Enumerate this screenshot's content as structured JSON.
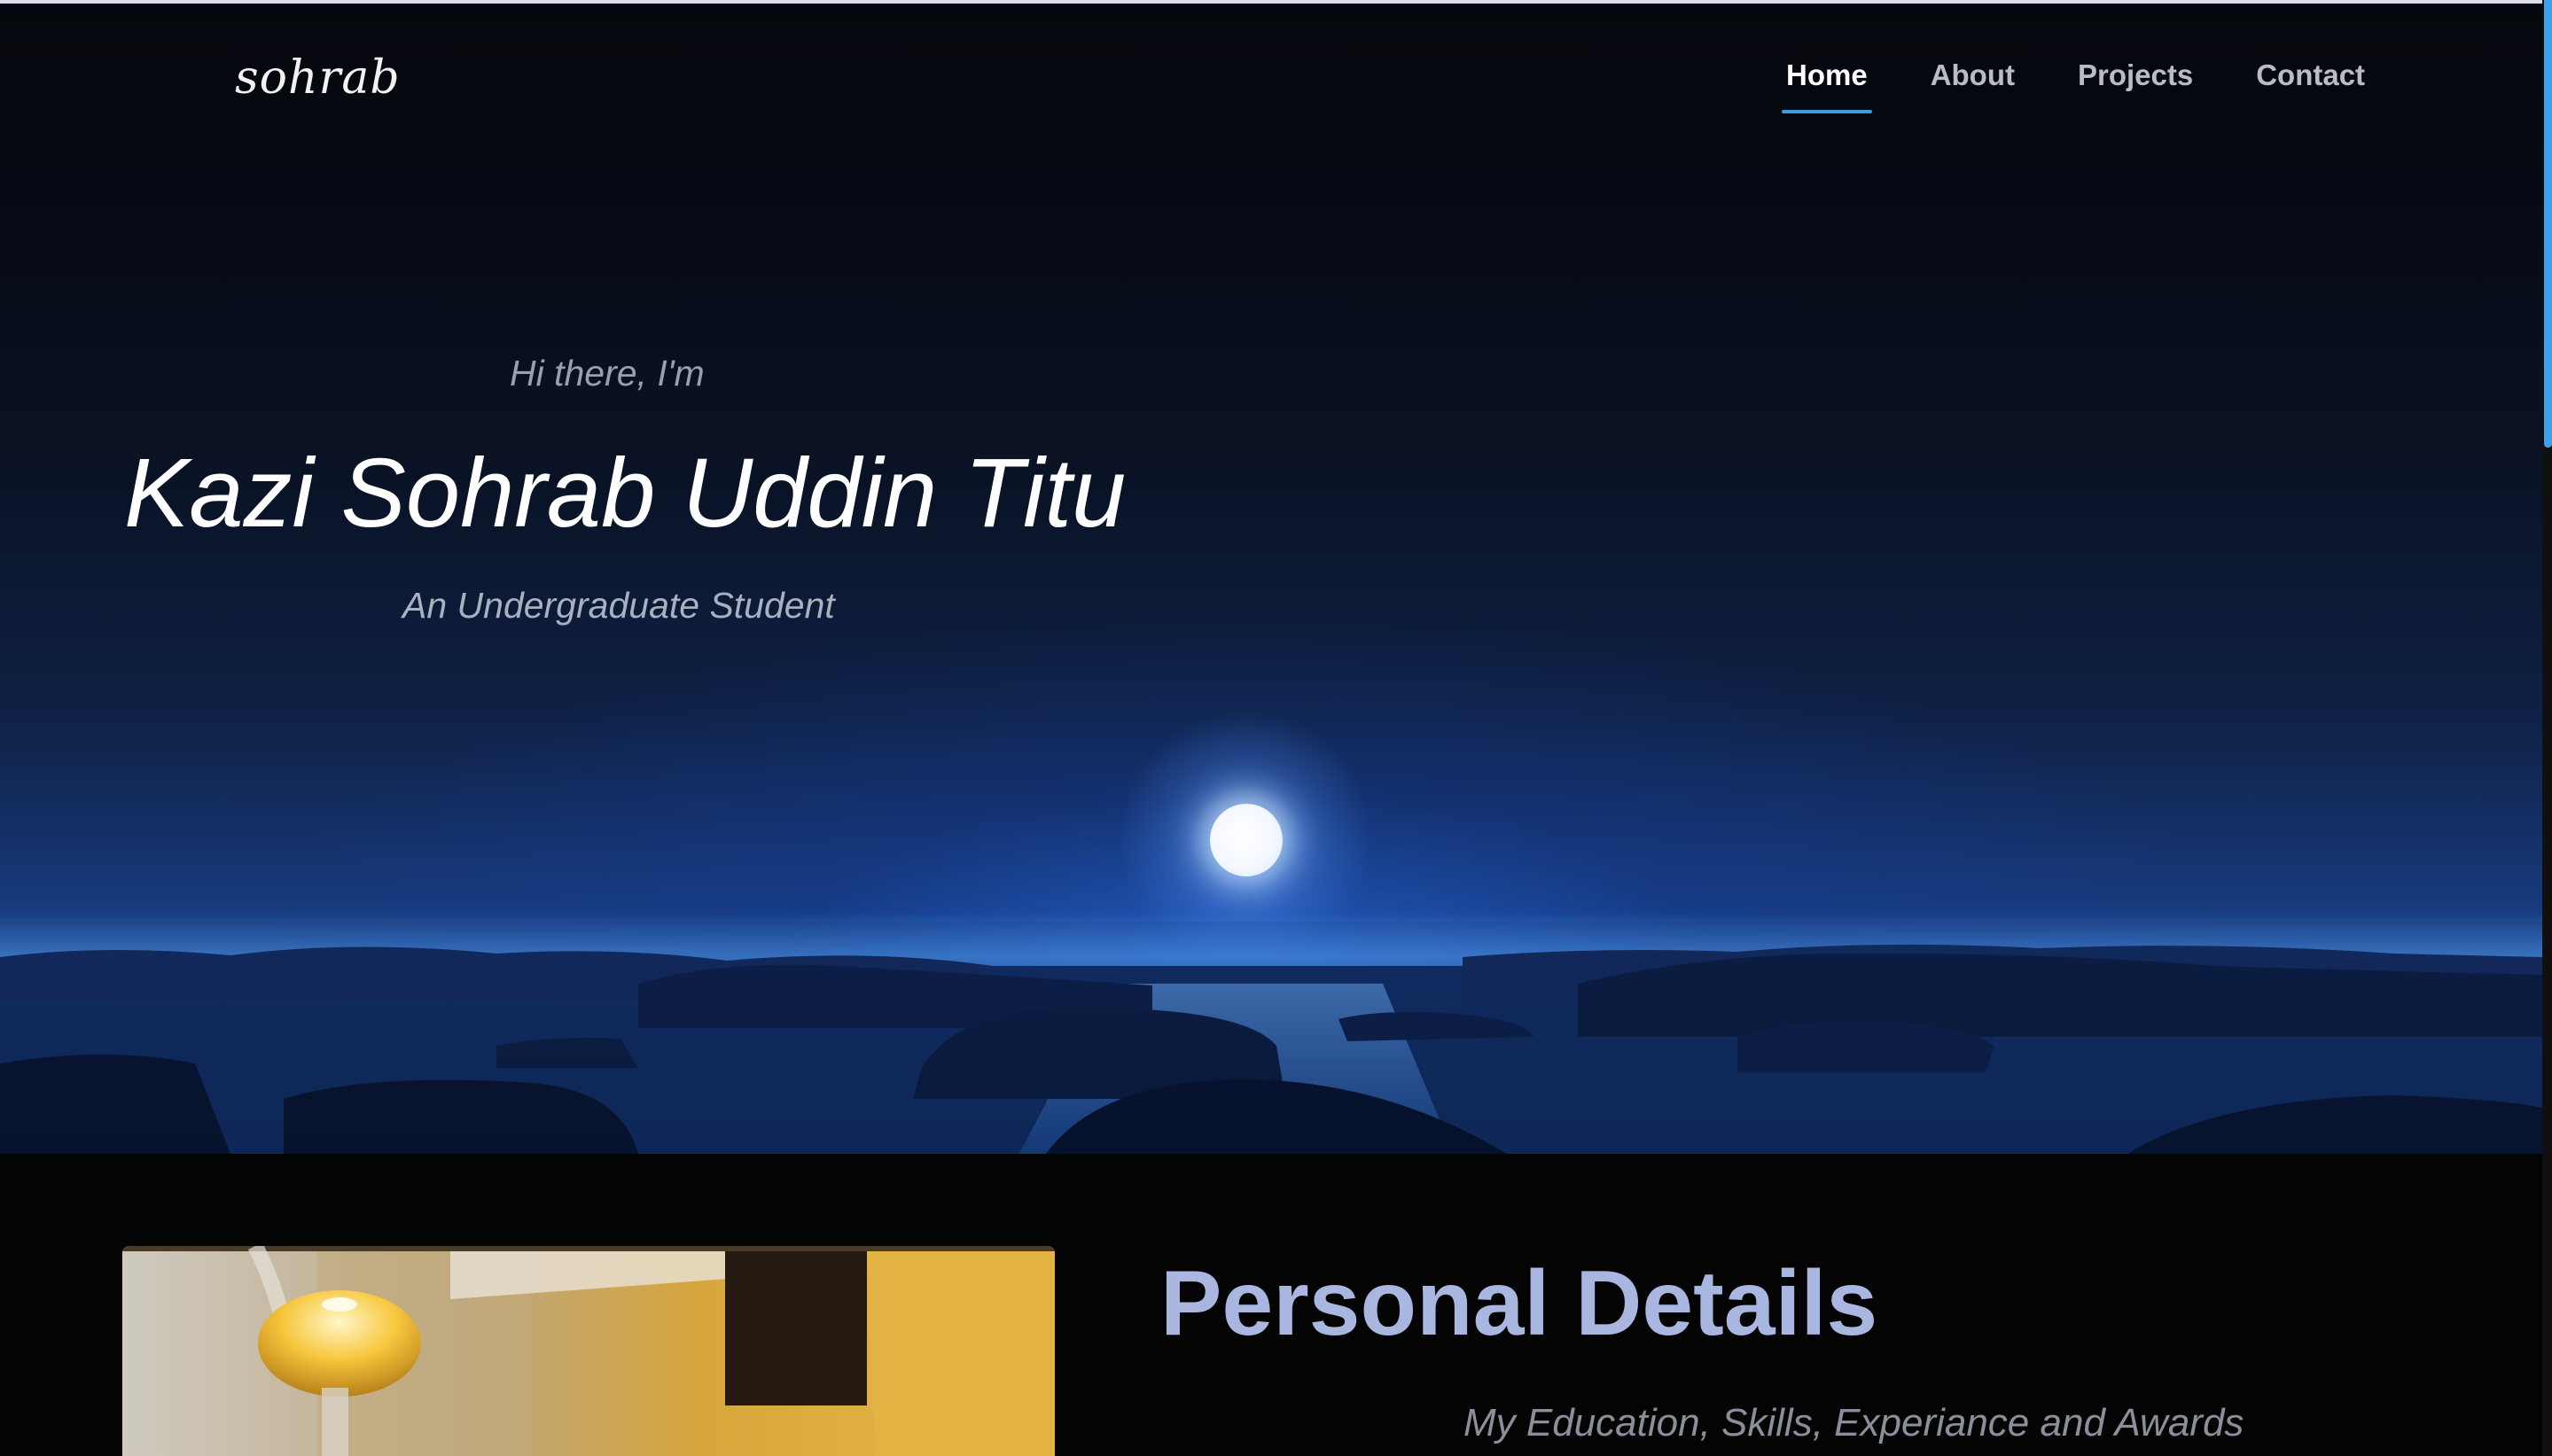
{
  "header": {
    "logo_text": "sohrab",
    "nav": [
      {
        "label": "Home",
        "active": true
      },
      {
        "label": "About",
        "active": false
      },
      {
        "label": "Projects",
        "active": false
      },
      {
        "label": "Contact",
        "active": false
      }
    ]
  },
  "hero": {
    "greeting": "Hi there, I'm",
    "name": "Kazi Sohrab Uddin Titu",
    "role": "An Undergraduate Student"
  },
  "details": {
    "title": "Personal Details",
    "subtitle": "My Education, Skills, Experiance and Awards"
  },
  "colors": {
    "accent": "#3a9be0",
    "title": "#a9b7e0",
    "background": "#040405"
  }
}
